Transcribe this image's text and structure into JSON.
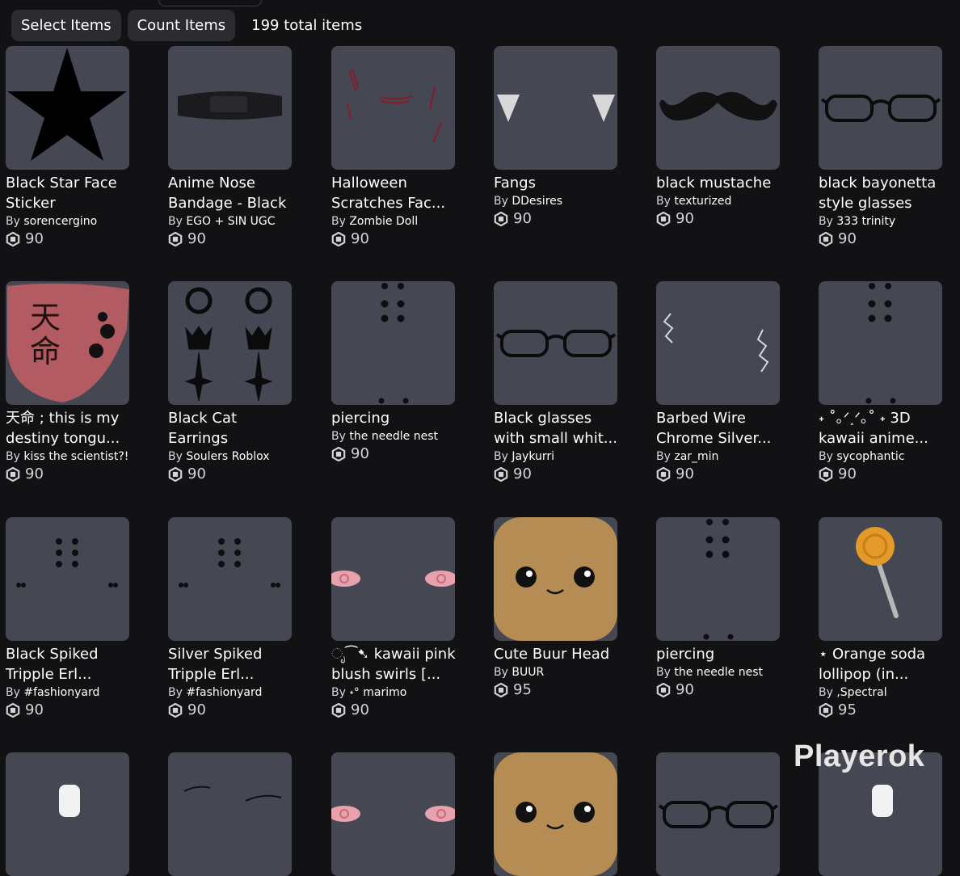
{
  "toolbar": {
    "select_label": "Select Items",
    "count_label": "Count Items",
    "total_text": "199 total items"
  },
  "by_prefix": "By",
  "colors": {
    "background": "#121215",
    "tile": "#454752",
    "button": "#2b2c31"
  },
  "items": [
    {
      "name": "Black Star Face Sticker",
      "creator": "sorencergino",
      "price": "90",
      "icon": "star-icon"
    },
    {
      "name": "Anime Nose Bandage - Black",
      "creator": "EGO + SIN UGC",
      "price": "90",
      "icon": "nose-bandage-icon"
    },
    {
      "name": "Halloween Scratches Fac...",
      "creator": "Zombie Doll",
      "price": "90",
      "icon": "scratches-icon"
    },
    {
      "name": "Fangs",
      "creator": "DDesires",
      "price": "90",
      "icon": "fangs-icon"
    },
    {
      "name": "black mustache",
      "creator": "texturized",
      "price": "90",
      "icon": "mustache-icon"
    },
    {
      "name": "black bayonetta style glasses",
      "creator": "333 trinity",
      "price": "90",
      "icon": "glasses-icon"
    },
    {
      "name": "天命 ; this is my destiny tongu...",
      "creator": "kiss the scientist?!",
      "price": "90",
      "icon": "tongue-icon"
    },
    {
      "name": "Black Cat Earrings",
      "creator": "Soulers Roblox",
      "price": "90",
      "icon": "earrings-icon"
    },
    {
      "name": "piercing",
      "creator": "the needle nest",
      "price": "90",
      "icon": "piercing-icon"
    },
    {
      "name": "Black glasses with small whit...",
      "creator": "Jaykurri",
      "price": "90",
      "icon": "glasses-icon"
    },
    {
      "name": "Barbed Wire Chrome Silver...",
      "creator": "zar_min",
      "price": "90",
      "icon": "barbed-wire-icon"
    },
    {
      "name": "˖ ˚｡ᐟ˰ᐟ｡˚ ˖ 3D kawaii anime...",
      "creator": "sycophantic",
      "price": "90",
      "icon": "piercing-icon"
    },
    {
      "name": "Black Spiked Tripple Erl...",
      "creator": "#fashionyard",
      "price": "90",
      "icon": "spiked-piercing-icon"
    },
    {
      "name": "Silver Spiked Tripple Erl...",
      "creator": "#fashionyard",
      "price": "90",
      "icon": "spiked-piercing-icon"
    },
    {
      "name": "ೃ⁀➷ kawaii pink blush swirls [...",
      "creator": "˖° marimo",
      "price": "90",
      "icon": "blush-icon"
    },
    {
      "name": "Cute Buur Head",
      "creator": "BUUR",
      "price": "95",
      "icon": "head-icon"
    },
    {
      "name": "piercing",
      "creator": "the needle nest",
      "price": "90",
      "icon": "piercing-icon"
    },
    {
      "name": "⋆ Orange soda lollipop (in...",
      "creator": ",Spectral",
      "price": "95",
      "icon": "lollipop-icon"
    },
    {
      "name": "",
      "creator": "",
      "price": "",
      "icon": "accessory-icon"
    },
    {
      "name": "",
      "creator": "",
      "price": "",
      "icon": "eyebrows-icon"
    },
    {
      "name": "",
      "creator": "",
      "price": "",
      "icon": "blush-icon"
    },
    {
      "name": "",
      "creator": "",
      "price": "",
      "icon": "head-icon"
    },
    {
      "name": "",
      "creator": "",
      "price": "",
      "icon": "glasses-icon"
    },
    {
      "name": "",
      "creator": "",
      "price": "",
      "icon": "accessory-icon"
    }
  ],
  "watermark": "Playerok"
}
